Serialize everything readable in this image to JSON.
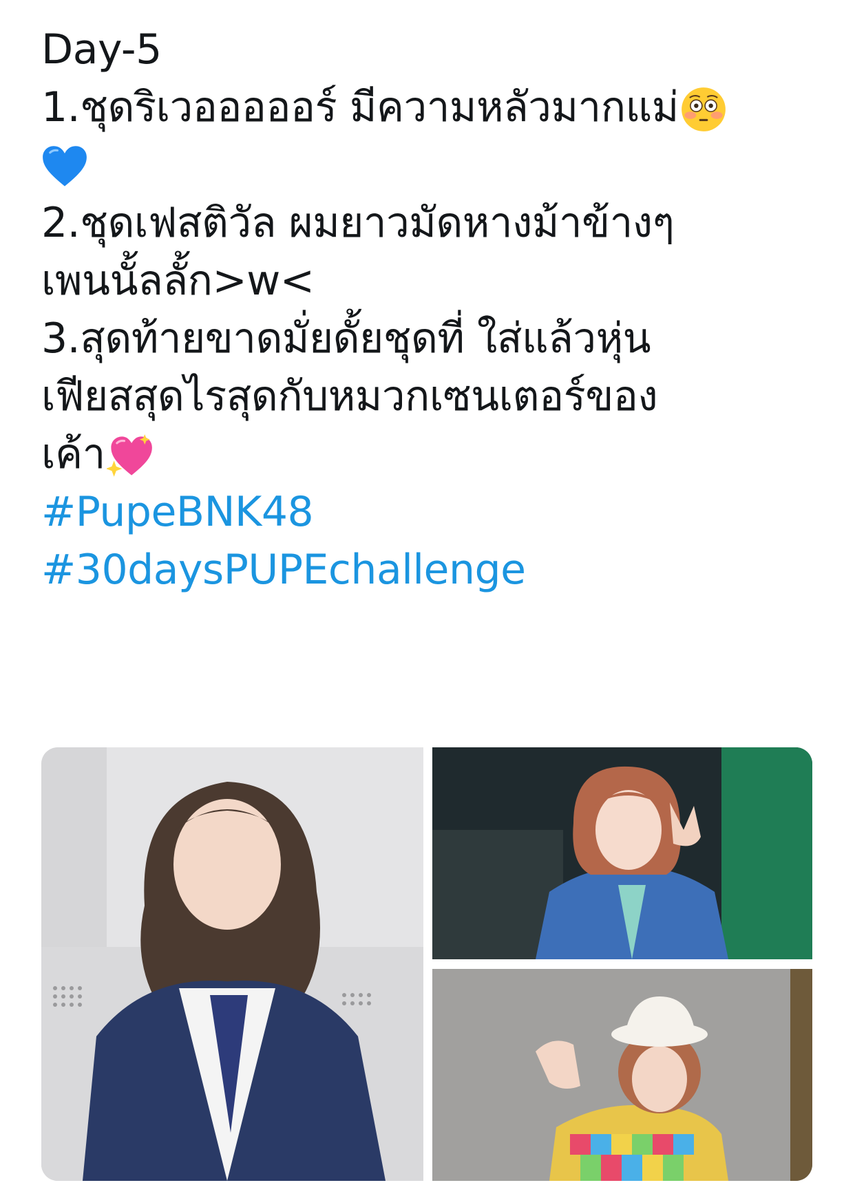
{
  "tweet": {
    "line1": "Day-5",
    "line2": "1.ชุดริเวอออออร์ มีความหลัวมากแม่",
    "line2_emoji": "flushed-face-emoji",
    "line3_emoji": "blue-heart-emoji",
    "line4": "2.ชุดเฟสติวัล ผมยาวมัดหางม้าข้างๆ",
    "line5": "เพนนั้ลลั้ก>w<",
    "line6": "3.สุดท้ายขาดมั่ยดั้ยชุดที่ ใส่แล้วหุ่น",
    "line7": "เฟียสสุดไรสุดกับหมวกเซนเตอร์ของ",
    "line8": "เค้า",
    "line8_emoji": "sparkling-heart-emoji",
    "hashtag1": "#PupeBNK48",
    "hashtag2": "#30daysPUPEchallenge"
  },
  "colors": {
    "text": "#14171a",
    "hashtag": "#1b95e0",
    "background": "#ffffff"
  },
  "media": [
    {
      "description_icon": "photo-laughing-girl-white-shirt-tie"
    },
    {
      "description_icon": "photo-girl-peace-sign-blue-costume"
    },
    {
      "description_icon": "photo-girl-white-hat-colorful-costume"
    }
  ]
}
